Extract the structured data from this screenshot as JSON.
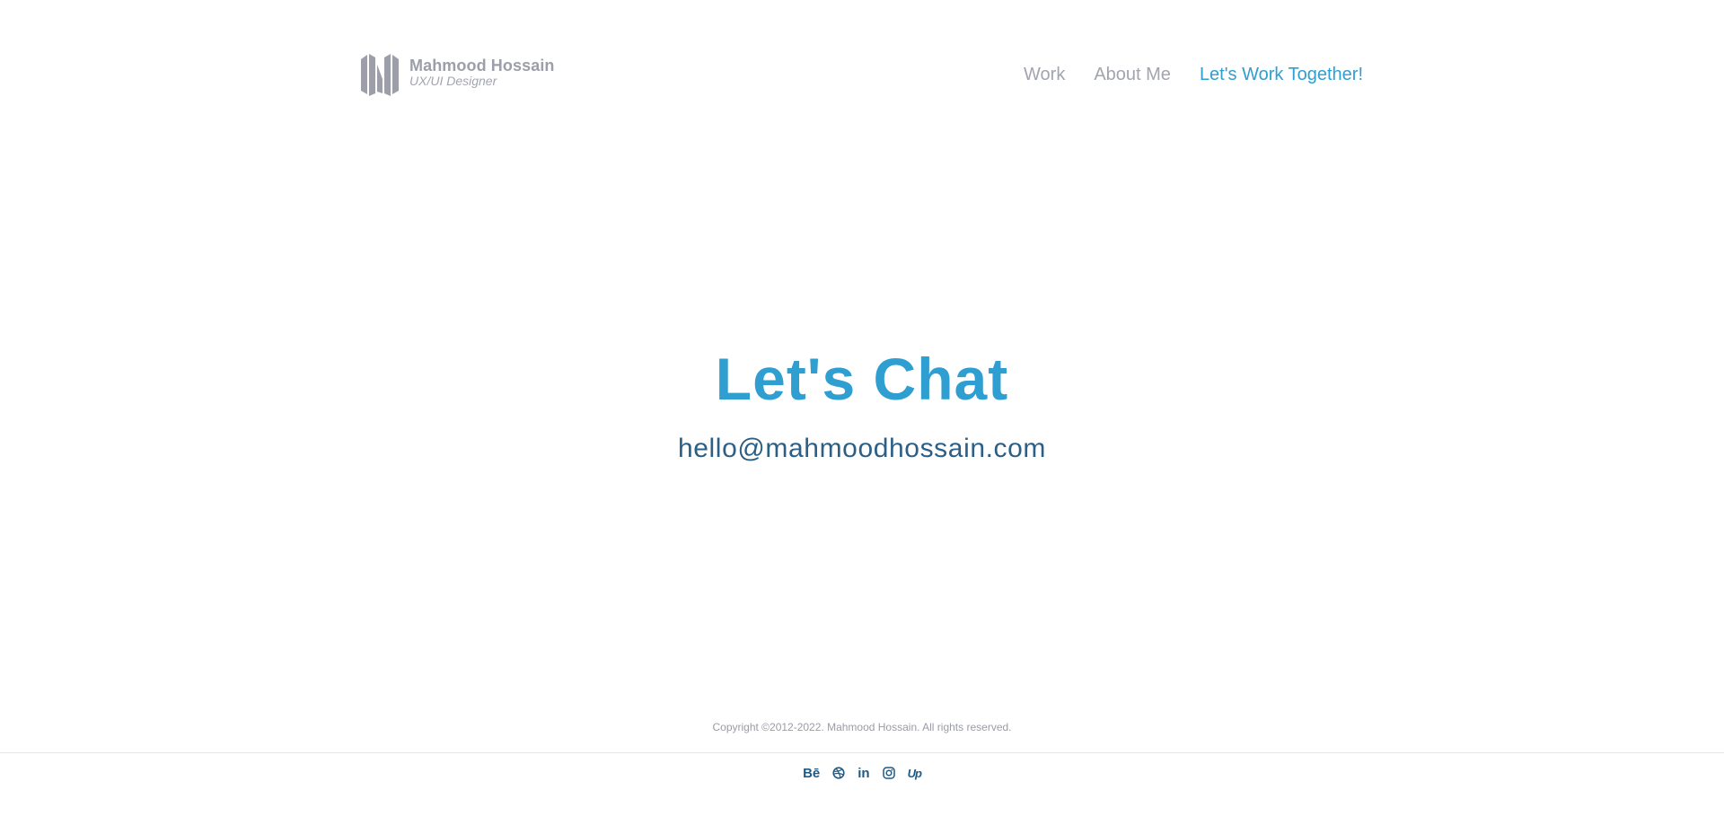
{
  "brand": {
    "name": "Mahmood Hossain",
    "role": "UX/UI Designer",
    "logo_icon": "mh-monogram-icon"
  },
  "nav": {
    "items": [
      {
        "label": "Work",
        "active": false
      },
      {
        "label": "About Me",
        "active": false
      },
      {
        "label": "Let's Work Together!",
        "active": true
      }
    ]
  },
  "hero": {
    "title": "Let's Chat",
    "email": "hello@mahmoodhossain.com"
  },
  "footer": {
    "copyright": "Copyright ©2012-2022. Mahmood Hossain. All rights reserved.",
    "socials": [
      {
        "name": "behance",
        "icon": "behance-icon",
        "label": "Bē"
      },
      {
        "name": "dribbble",
        "icon": "dribbble-icon"
      },
      {
        "name": "linkedin",
        "icon": "linkedin-icon",
        "label": "in"
      },
      {
        "name": "instagram",
        "icon": "instagram-icon"
      },
      {
        "name": "upwork",
        "icon": "upwork-icon",
        "label": "Up"
      }
    ]
  },
  "colors": {
    "accent": "#2f9ed0",
    "muted": "#a2a4ae",
    "email": "#2c5f86",
    "social": "#1f5a86"
  }
}
